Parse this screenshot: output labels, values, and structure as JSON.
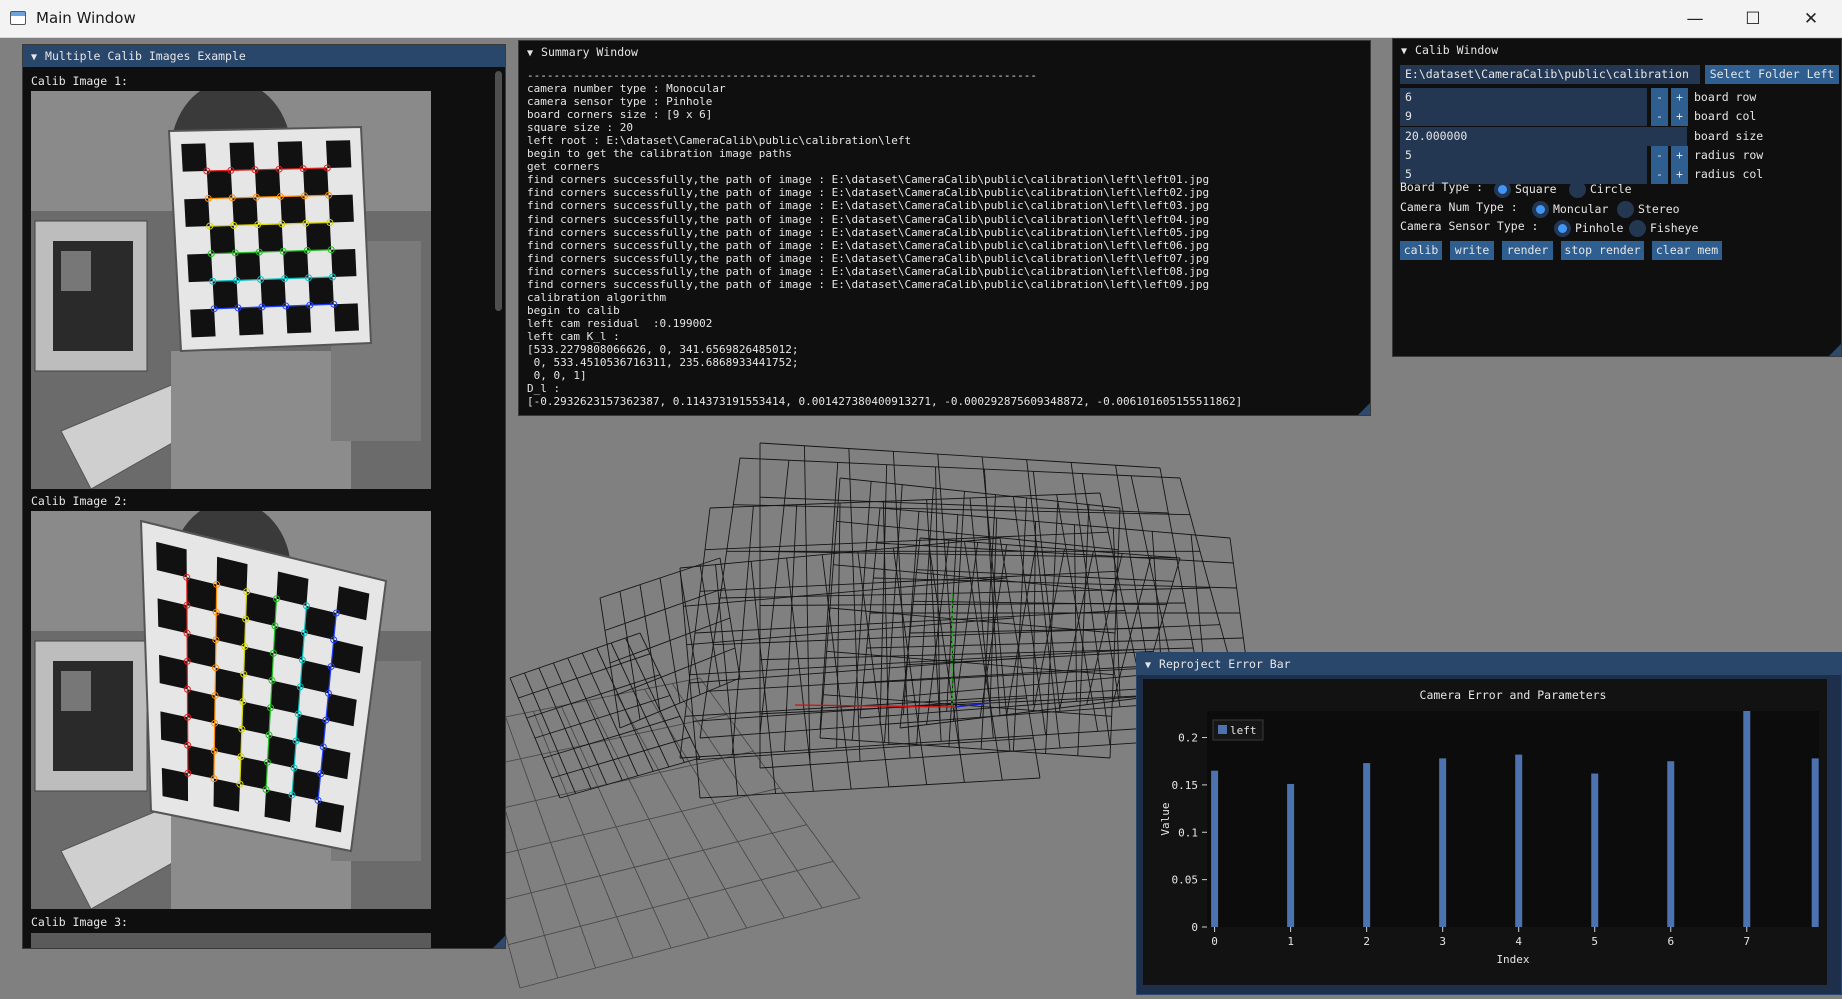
{
  "os_window": {
    "title": "Main Window",
    "minimize": "—",
    "maximize": "☐",
    "close": "✕"
  },
  "calib_images_window": {
    "title": "Multiple Calib Images Example",
    "images": [
      {
        "label": "Calib Image 1:"
      },
      {
        "label": "Calib Image 2:"
      },
      {
        "label": "Calib Image 3:"
      }
    ]
  },
  "summary_window": {
    "title": "Summary Window",
    "lines": [
      "-----------------------------------------------------------------------------",
      "camera number type : Monocular",
      "camera sensor type : Pinhole",
      "board corners size : [9 x 6]",
      "square size : 20",
      "left root : E:\\dataset\\CameraCalib\\public\\calibration\\left",
      "begin to get the calibration image paths",
      "get corners",
      "find corners successfully,the path of image : E:\\dataset\\CameraCalib\\public\\calibration\\left\\left01.jpg",
      "find corners successfully,the path of image : E:\\dataset\\CameraCalib\\public\\calibration\\left\\left02.jpg",
      "find corners successfully,the path of image : E:\\dataset\\CameraCalib\\public\\calibration\\left\\left03.jpg",
      "find corners successfully,the path of image : E:\\dataset\\CameraCalib\\public\\calibration\\left\\left04.jpg",
      "find corners successfully,the path of image : E:\\dataset\\CameraCalib\\public\\calibration\\left\\left05.jpg",
      "find corners successfully,the path of image : E:\\dataset\\CameraCalib\\public\\calibration\\left\\left06.jpg",
      "find corners successfully,the path of image : E:\\dataset\\CameraCalib\\public\\calibration\\left\\left07.jpg",
      "find corners successfully,the path of image : E:\\dataset\\CameraCalib\\public\\calibration\\left\\left08.jpg",
      "find corners successfully,the path of image : E:\\dataset\\CameraCalib\\public\\calibration\\left\\left09.jpg",
      "calibration algorithm",
      "begin to calib",
      "left cam residual  :0.199002",
      "left cam K_l :",
      "[533.2279808066626, 0, 341.6569826485012;",
      " 0, 533.4510536716311, 235.6868933441752;",
      " 0, 0, 1]",
      "D_l :",
      "[-0.2932623157362387, 0.114373191553414, 0.001427380400913271, -0.000292875609348872, -0.006101605155511862]"
    ]
  },
  "calib_window": {
    "title": "Calib Window",
    "folder_path": "E:\\dataset\\CameraCalib\\public\\calibration",
    "select_folder_label": "Select Folder Left",
    "fields": [
      {
        "value": "6",
        "label": "board row",
        "stepper": true
      },
      {
        "value": "9",
        "label": "board col",
        "stepper": true
      },
      {
        "value": "20.000000",
        "label": "board size",
        "stepper": false
      },
      {
        "value": "5",
        "label": "radius row",
        "stepper": true
      },
      {
        "value": "5",
        "label": "radius col",
        "stepper": true
      }
    ],
    "stepper_minus": "-",
    "stepper_plus": "+",
    "board_type": {
      "label": "Board Type :",
      "options": [
        "Square",
        "Circle"
      ],
      "selected": "Square"
    },
    "camera_num_type": {
      "label": "Camera Num Type :",
      "options": [
        "Moncular",
        "Stereo"
      ],
      "selected": "Moncular"
    },
    "camera_sensor_type": {
      "label": "Camera Sensor Type :",
      "options": [
        "Pinhole",
        "Fisheye"
      ],
      "selected": "Pinhole"
    },
    "buttons": [
      "calib",
      "write",
      "render",
      "stop render",
      "clear mem"
    ]
  },
  "reproject_window": {
    "title": "Reproject Error Bar"
  },
  "chart_data": {
    "type": "bar",
    "title": "Camera Error and Parameters",
    "xlabel": "Index",
    "ylabel": "Value",
    "ylim": [
      0,
      0.228
    ],
    "xlim": [
      -0.1,
      7.95
    ],
    "yticks": [
      0,
      0.05,
      0.1,
      0.15,
      0.2
    ],
    "ytick_labels": [
      "0",
      "0.05",
      "0.1",
      "0.15",
      "0.2"
    ],
    "xticks": [
      0,
      1,
      2,
      3,
      4,
      5,
      6,
      7
    ],
    "xtick_labels": [
      "0",
      "1",
      "2",
      "3",
      "4",
      "5",
      "6",
      "7"
    ],
    "legend": [
      "left"
    ],
    "legend_position": "top-left",
    "grid": false,
    "bar_color": "#4c72b0",
    "series": [
      {
        "name": "left",
        "x": [
          0,
          1,
          2,
          3,
          4,
          5,
          6,
          7,
          7.9
        ],
        "values": [
          0.165,
          0.151,
          0.173,
          0.178,
          0.182,
          0.162,
          0.175,
          0.228,
          0.178
        ]
      }
    ]
  },
  "colors": {
    "imgui_title_active": "#29466b",
    "imgui_frame_bg": "#233752",
    "imgui_button": "#2f5e91",
    "imgui_check": "#4296fa",
    "viewport_bg": "#808080"
  }
}
